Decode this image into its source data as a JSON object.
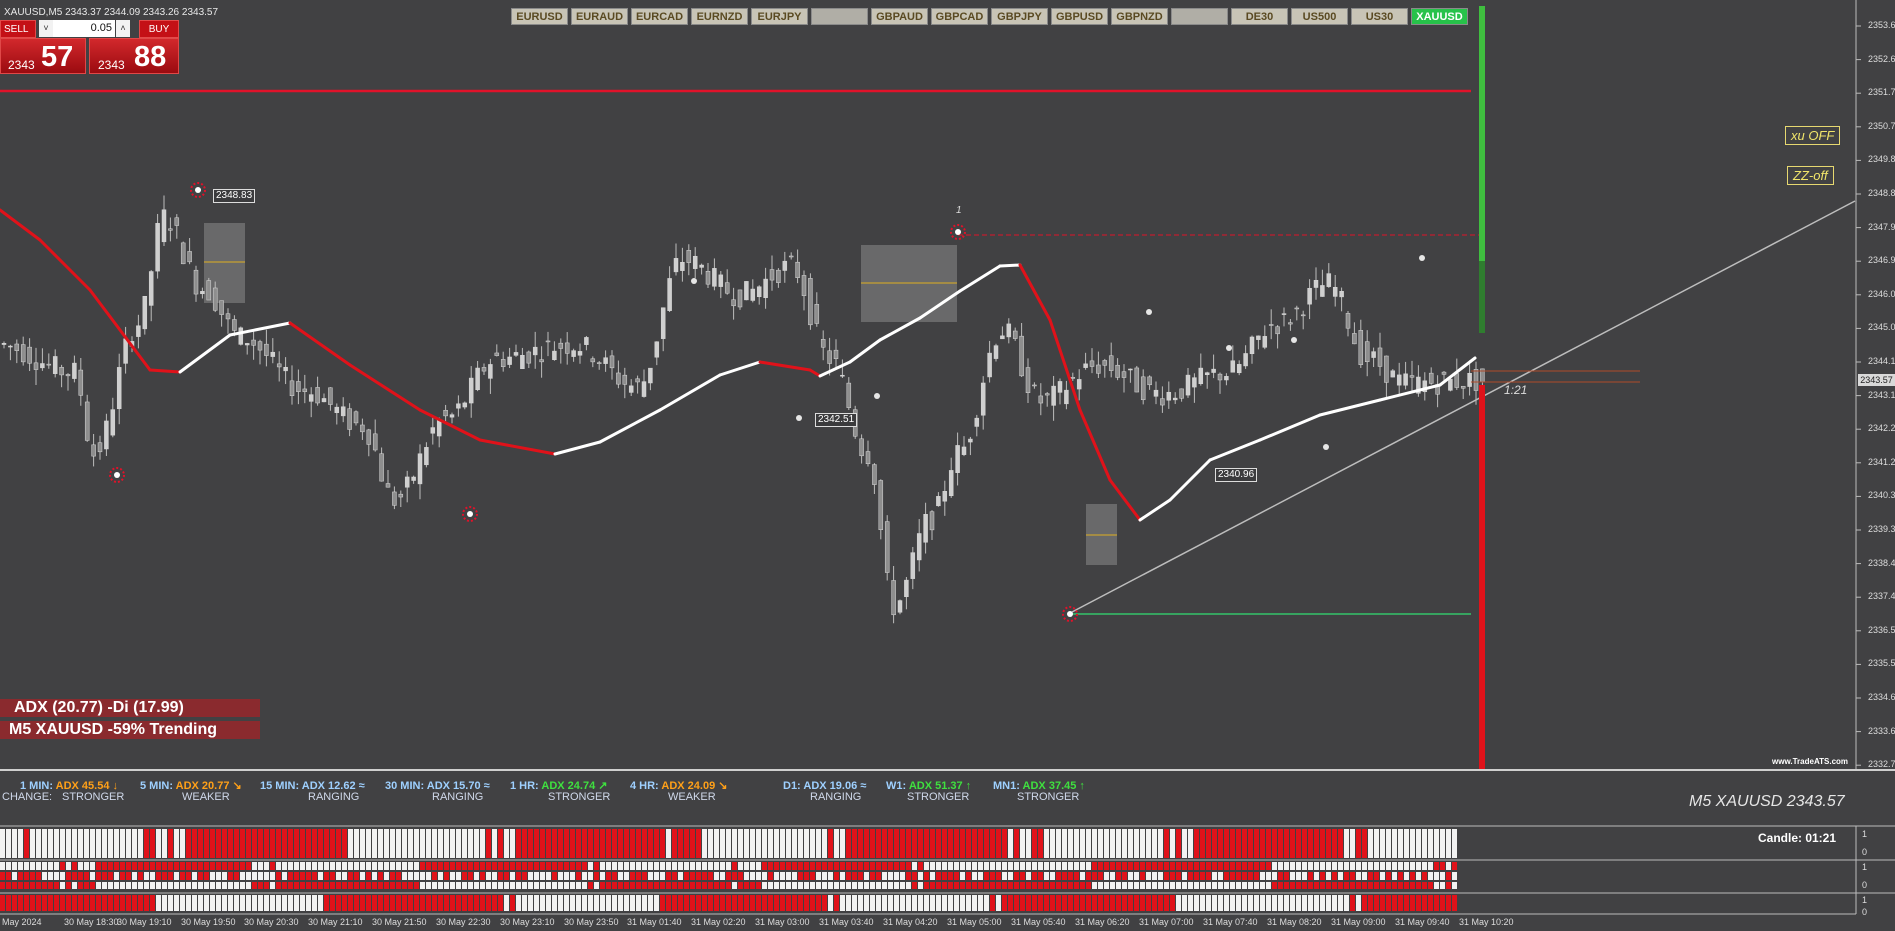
{
  "header": {
    "text": "XAUUSD,M5  2343.37 2344.09 2343.26 2343.57"
  },
  "trade_panel": {
    "sell_label": "SELL",
    "buy_label": "BUY",
    "lot_value": "0.05",
    "lot_down": "˅",
    "lot_up": "˄",
    "sell_price_small": "2343",
    "sell_price_big": "57",
    "buy_price_small": "2343",
    "buy_price_big": "88"
  },
  "symbols": [
    "EURUSD",
    "EURAUD",
    "EURCAD",
    "EURNZD",
    "EURJPY",
    "",
    "GBPAUD",
    "GBPCAD",
    "GBPJPY",
    "GBPUSD",
    "GBPNZD",
    "",
    "DE30",
    "US500",
    "US30",
    "XAUUSD"
  ],
  "active_symbol": "XAUUSD",
  "price_axis": [
    "2353.60",
    "2352.65",
    "2351.70",
    "2350.75",
    "2349.80",
    "2348.85",
    "2347.90",
    "2346.95",
    "2346.00",
    "2345.05",
    "2344.10",
    "2343.15",
    "2342.20",
    "2341.25",
    "2340.30",
    "2339.35",
    "2338.40",
    "2337.45",
    "2336.50",
    "2335.55",
    "2334.60",
    "2333.65",
    "2332.70"
  ],
  "current_price_label": "2343.57",
  "time_axis": [
    "May 2024",
    "30 May 18:30",
    "30 May 19:10",
    "30 May 19:50",
    "30 May 20:30",
    "30 May 21:10",
    "30 May 21:50",
    "30 May 22:30",
    "30 May 23:10",
    "30 May 23:50",
    "31 May 01:40",
    "31 May 02:20",
    "31 May 03:00",
    "31 May 03:40",
    "31 May 04:20",
    "31 May 05:00",
    "31 May 05:40",
    "31 May 06:20",
    "31 May 07:00",
    "31 May 07:40",
    "31 May 08:20",
    "31 May 09:00",
    "31 May 09:40",
    "31 May 10:20"
  ],
  "level_labels": {
    "high": "2348.83",
    "mid": "2342.51",
    "low": "2340.96"
  },
  "fractal_mark": "1",
  "countdown_label": "1:21",
  "controls": {
    "xu": "xu OFF",
    "zz": "ZZ-off"
  },
  "adx_line": "ADX (20.77)  -Di (17.99)",
  "trend_line": "M5 XAUUSD -59% Trending",
  "watermark": "www.TradeATS.com",
  "change_label": "CHANGE:",
  "timeframes": [
    {
      "tf": "1 MIN:",
      "adx": "ADX 45.54",
      "state": "STRONGER",
      "color": "#ffa018",
      "arrow": "↓"
    },
    {
      "tf": "5 MIN:",
      "adx": "ADX 20.77",
      "state": "WEAKER",
      "color": "#ffa018",
      "arrow": "↘"
    },
    {
      "tf": "15 MIN:",
      "adx": "ADX 12.62",
      "state": "RANGING",
      "color": "#9ed0ff",
      "arrow": "≈"
    },
    {
      "tf": "30 MIN:",
      "adx": "ADX 15.70",
      "state": "RANGING",
      "color": "#9ed0ff",
      "arrow": "≈"
    },
    {
      "tf": "1 HR:",
      "adx": "ADX 24.74",
      "state": "STRONGER",
      "color": "#3fe03f",
      "arrow": "↗"
    },
    {
      "tf": "4 HR:",
      "adx": "ADX 24.09",
      "state": "WEAKER",
      "color": "#ffa018",
      "arrow": "↘"
    },
    {
      "tf": "D1:",
      "adx": "ADX 19.06",
      "state": "RANGING",
      "color": "#9ed0ff",
      "arrow": "≈"
    },
    {
      "tf": "W1:",
      "adx": "ADX 51.37",
      "state": "STRONGER",
      "color": "#3fe03f",
      "arrow": "↑"
    },
    {
      "tf": "MN1:",
      "adx": "ADX 37.45",
      "state": "STRONGER",
      "color": "#3fe03f",
      "arrow": "↑"
    }
  ],
  "symbol_price": "M5 XAUUSD 2343.57",
  "candle_timer": "Candle:  01:21",
  "sub_axis": [
    "1",
    "0",
    "1",
    "0",
    "1",
    "0"
  ],
  "colors": {
    "background": "#414143",
    "bull": "#f2f2f2",
    "bear": "#e0121a",
    "ma_up": "#ffffff",
    "ma_down": "#e0121a"
  }
}
